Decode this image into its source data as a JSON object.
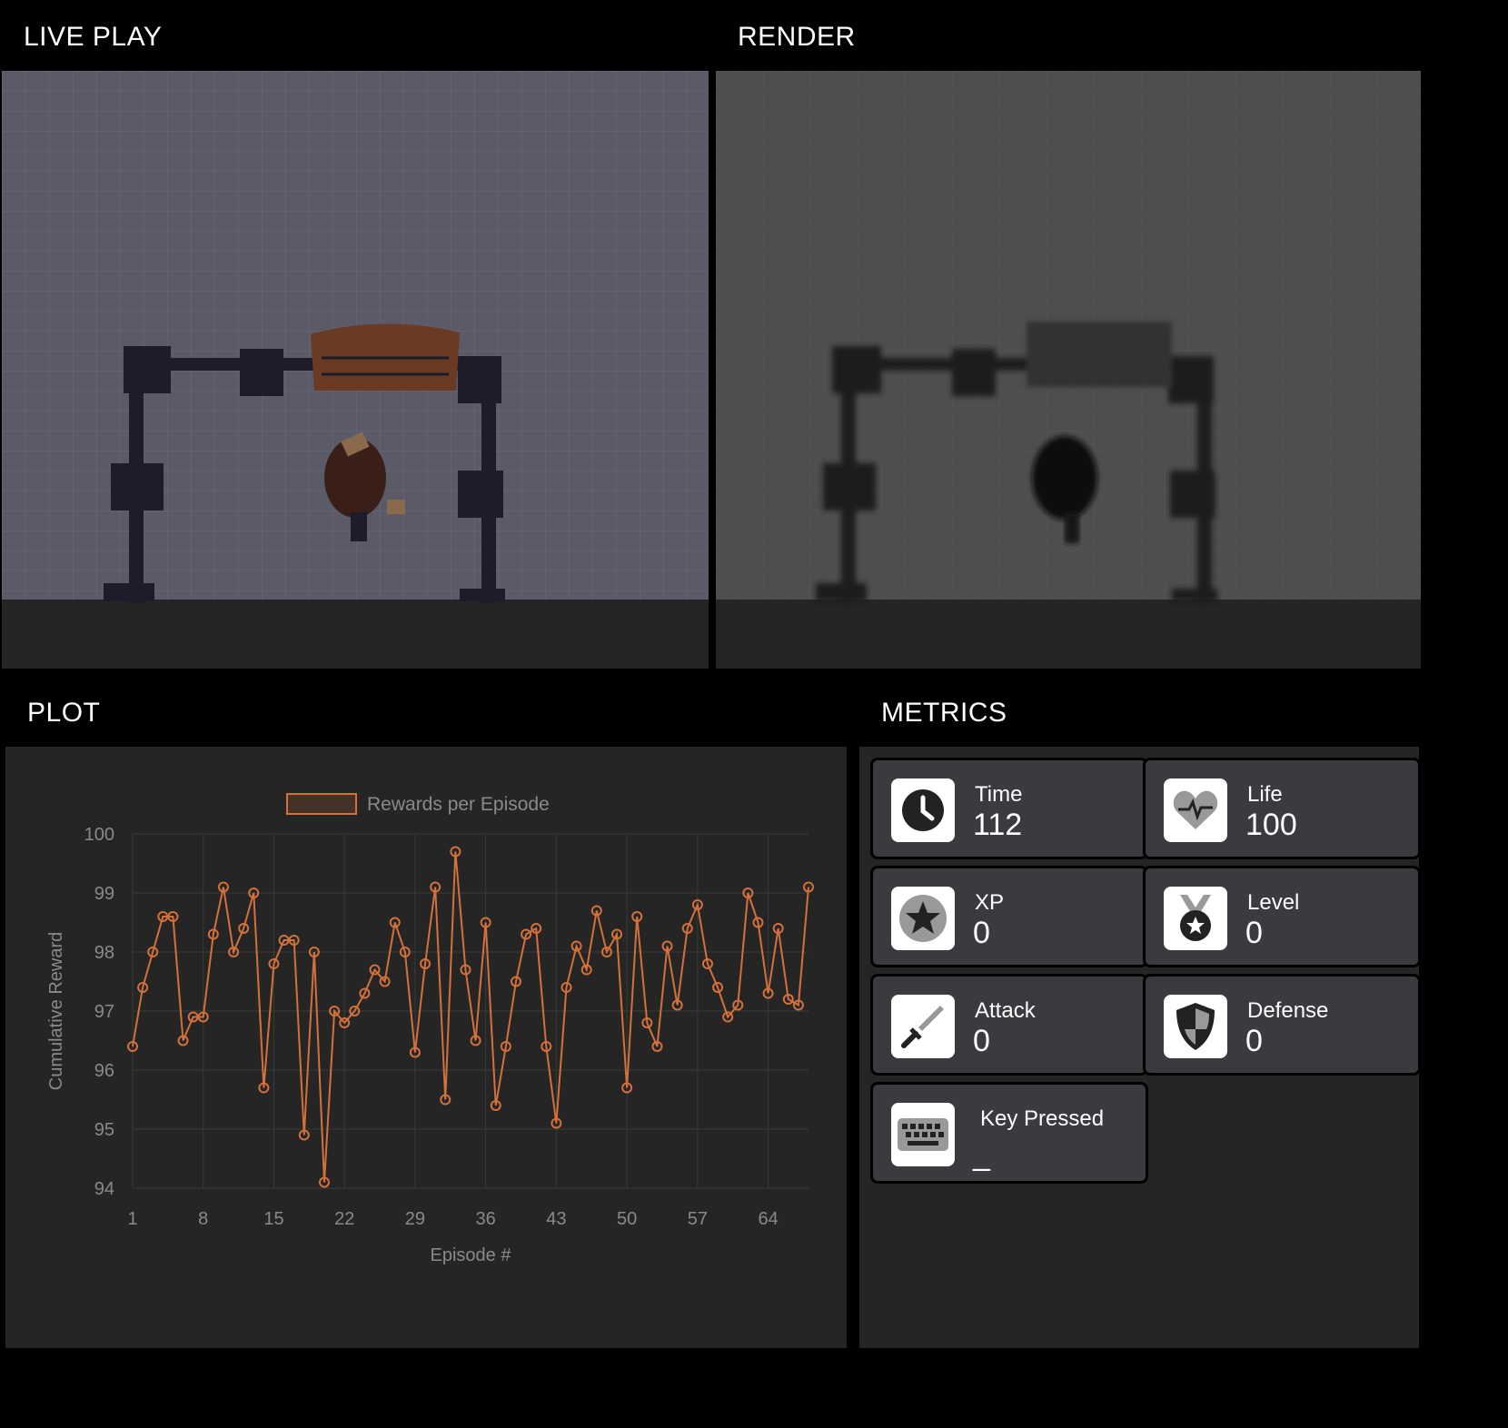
{
  "panels": {
    "live_play": "LIVE PLAY",
    "render": "RENDER",
    "plot": "PLOT",
    "metrics": "METRICS"
  },
  "chart_data": {
    "type": "line",
    "legend": "Rewards per Episode",
    "legend_position": "top-center",
    "xlabel": "Episode #",
    "ylabel": "Cumulative Reward",
    "ylim": [
      94,
      100
    ],
    "yticks": [
      94,
      95,
      96,
      97,
      98,
      99,
      100
    ],
    "xticks": [
      1,
      8,
      15,
      22,
      29,
      36,
      43,
      50,
      57,
      64
    ],
    "grid": true,
    "color": "#d4703a",
    "series": [
      {
        "x": [
          1,
          2,
          3,
          4,
          5,
          6,
          7,
          8,
          9,
          10,
          11,
          12,
          13,
          14,
          15,
          16,
          17,
          18,
          19,
          20,
          21,
          22,
          23,
          24,
          25,
          26,
          27,
          28,
          29,
          30,
          31,
          32,
          33,
          34,
          35,
          36,
          37,
          38,
          39,
          40,
          41,
          42,
          43,
          44,
          45,
          46,
          47,
          48,
          49,
          50,
          51,
          52,
          53,
          54,
          55,
          56,
          57,
          58,
          59,
          60,
          61,
          62,
          63,
          64,
          65,
          66,
          67,
          68
        ],
        "values": [
          96.4,
          97.4,
          98.0,
          98.6,
          98.6,
          96.5,
          96.9,
          96.9,
          98.3,
          99.1,
          98.0,
          98.4,
          99.0,
          95.7,
          97.8,
          98.2,
          98.2,
          94.9,
          98.0,
          94.1,
          97.0,
          96.8,
          97.0,
          97.3,
          97.7,
          97.5,
          98.5,
          98.0,
          96.3,
          97.8,
          99.1,
          95.5,
          99.7,
          97.7,
          96.5,
          98.5,
          95.4,
          96.4,
          97.5,
          98.3,
          98.4,
          96.4,
          95.1,
          97.4,
          98.1,
          97.7,
          98.7,
          98.0,
          98.3,
          95.7,
          98.6,
          96.8,
          96.4,
          98.1,
          97.1,
          98.4,
          98.8,
          97.8,
          97.4,
          96.9,
          97.1,
          99.0,
          98.5,
          97.3,
          98.4,
          97.2,
          97.1,
          99.1
        ]
      }
    ]
  },
  "metrics": [
    {
      "label": "Time",
      "value": "112",
      "icon": "clock-icon"
    },
    {
      "label": "Life",
      "value": "100",
      "icon": "heart-icon"
    },
    {
      "label": "XP",
      "value": "0",
      "icon": "star-icon"
    },
    {
      "label": "Level",
      "value": "0",
      "icon": "medal-icon"
    },
    {
      "label": "Attack",
      "value": "0",
      "icon": "sword-icon"
    },
    {
      "label": "Defense",
      "value": "0",
      "icon": "shield-icon"
    },
    {
      "label": "Key Pressed",
      "value": "_",
      "icon": "keyboard-icon"
    }
  ]
}
